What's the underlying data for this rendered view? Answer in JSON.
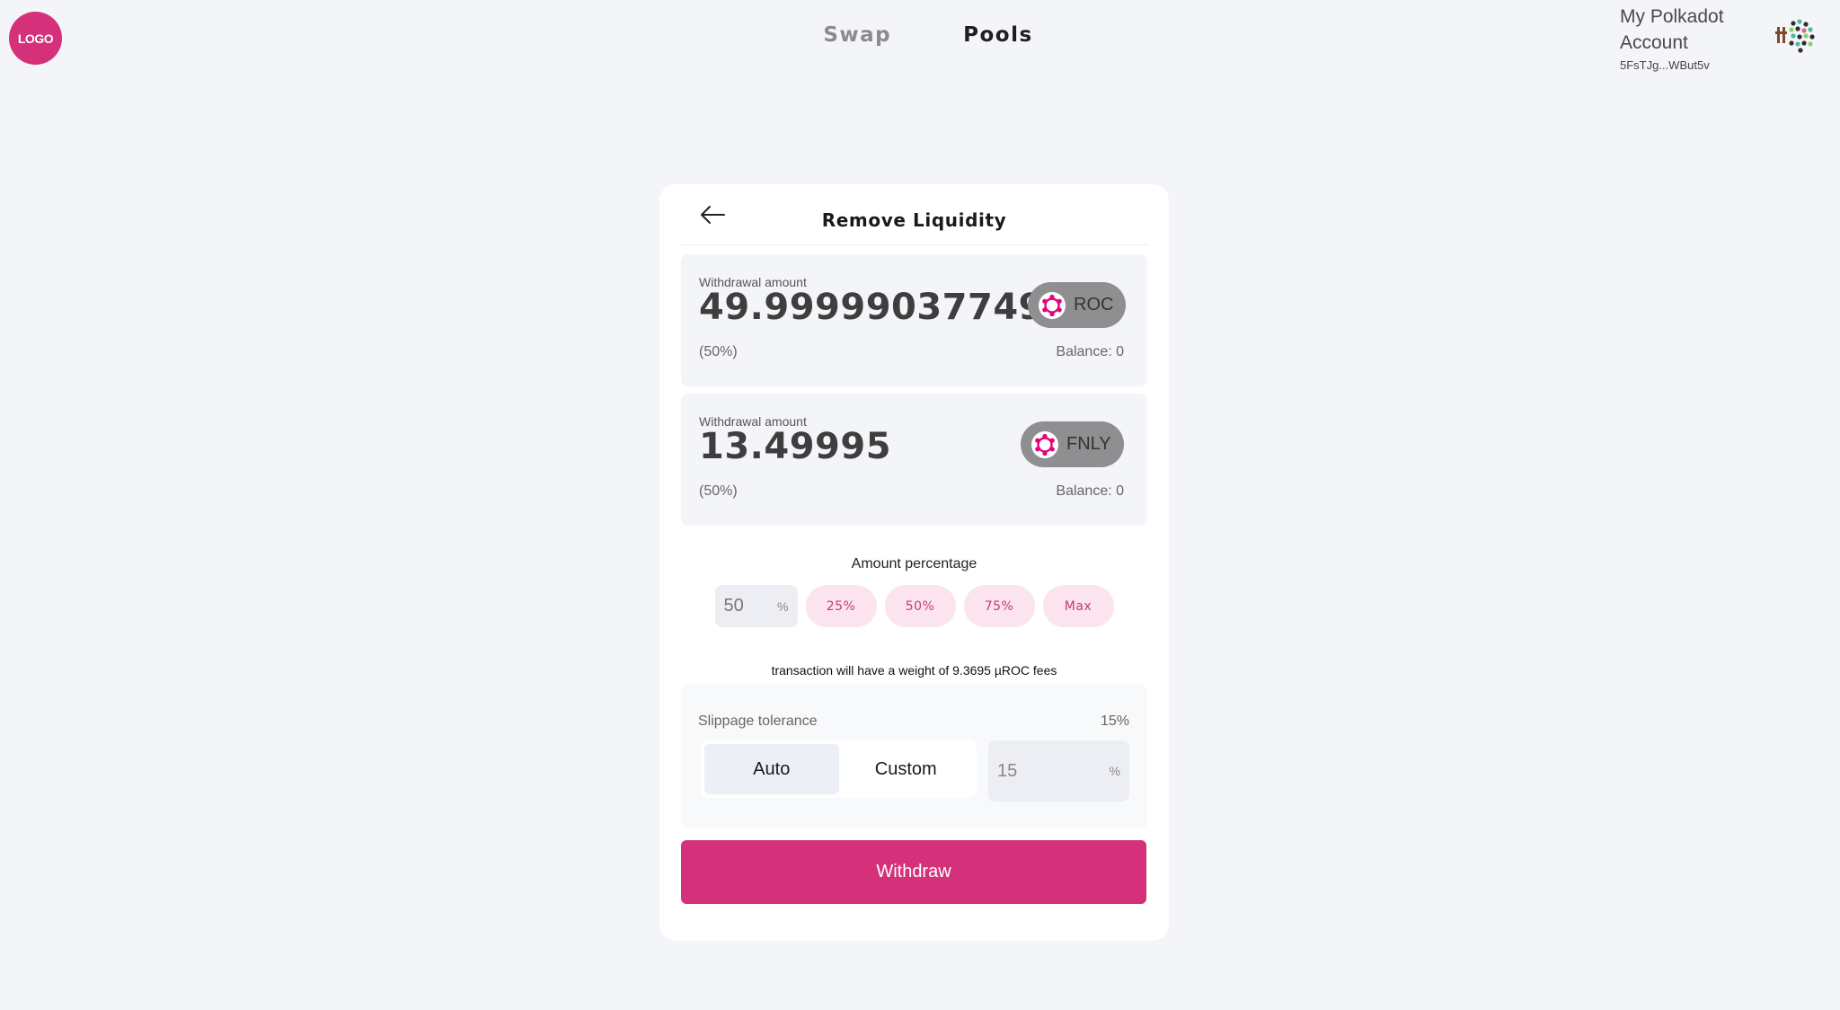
{
  "header": {
    "logo_text": "LOGO",
    "nav": [
      {
        "label": "Swap",
        "active": false
      },
      {
        "label": "Pools",
        "active": true
      }
    ],
    "account": {
      "name": "My Polkadot Account",
      "address": "5FsTJg...WBut5v"
    }
  },
  "card": {
    "title": "Remove Liquidity",
    "tokens": [
      {
        "label": "Withdrawal amount",
        "amount": "49.99999037749",
        "symbol": "ROC",
        "percent": "(50%)",
        "balance": "Balance: 0"
      },
      {
        "label": "Withdrawal amount",
        "amount": "13.49995",
        "symbol": "FNLY",
        "percent": "(50%)",
        "balance": "Balance: 0"
      }
    ],
    "amount_percentage": {
      "title": "Amount percentage",
      "input_value": "50",
      "unit": "%",
      "buttons": [
        "25%",
        "50%",
        "75%",
        "Max"
      ]
    },
    "fee_text": "transaction will have a weight of 9.3695 µROC fees",
    "slippage": {
      "label": "Slippage tolerance",
      "value": "15%",
      "options": [
        "Auto",
        "Custom"
      ],
      "selected": "Auto",
      "input_value": "15",
      "unit": "%"
    },
    "withdraw_label": "Withdraw"
  },
  "colors": {
    "accent": "#d4317a",
    "background": "#f4f5f9",
    "pill": "#8f8f92"
  }
}
